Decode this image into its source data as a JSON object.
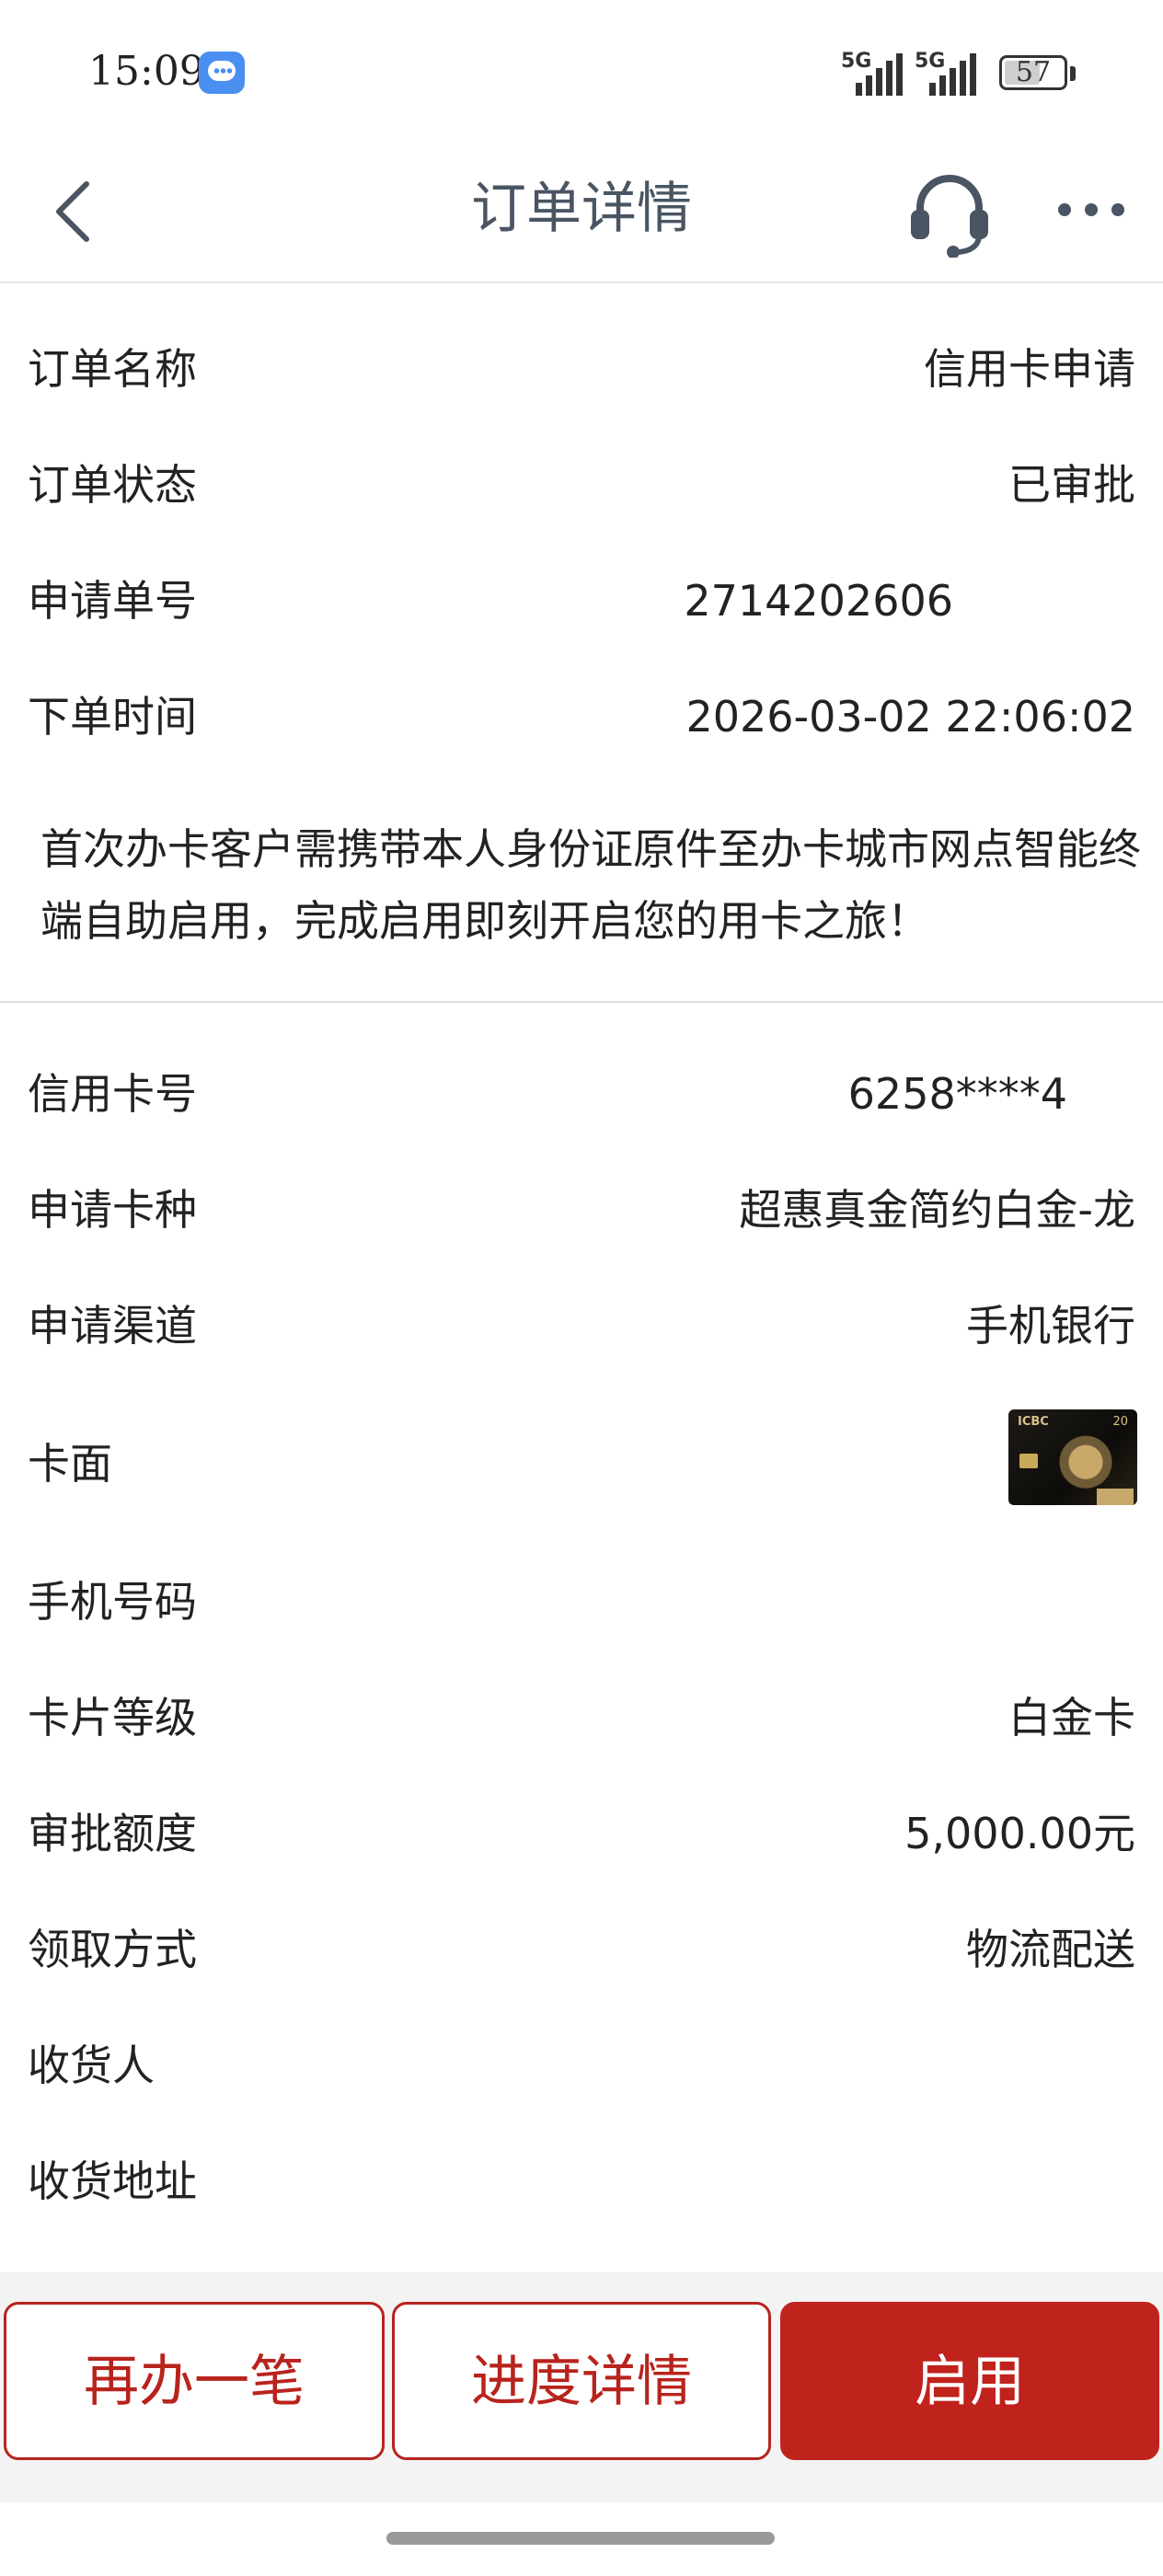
{
  "status_bar": {
    "time": "15:09",
    "battery": "57",
    "network1": "5G",
    "network2": "5G"
  },
  "header": {
    "title": "订单详情"
  },
  "order": {
    "rows": [
      {
        "label": "订单名称",
        "value": "信用卡申请"
      },
      {
        "label": "订单状态",
        "value": "已审批"
      },
      {
        "label": "申请单号",
        "value": "2714202606"
      },
      {
        "label": "下单时间",
        "value": "2026-03-02 22:06:02"
      }
    ],
    "notice": "首次办卡客户需携带本人身份证原件至办卡城市网点智能终端自助启用，完成启用即刻开启您的用卡之旅！"
  },
  "card": {
    "rows": [
      {
        "label": "信用卡号",
        "value": "6258****4"
      },
      {
        "label": "申请卡种",
        "value": "超惠真金简约白金-龙"
      },
      {
        "label": "申请渠道",
        "value": "手机银行"
      },
      {
        "label": "卡面",
        "value": ""
      },
      {
        "label": "手机号码",
        "value": ""
      },
      {
        "label": "卡片等级",
        "value": "白金卡"
      },
      {
        "label": "审批额度",
        "value": "5,000.00元"
      },
      {
        "label": "领取方式",
        "value": "物流配送"
      },
      {
        "label": "收货人",
        "value": ""
      },
      {
        "label": "收货地址",
        "value": ""
      }
    ],
    "face_logo": "ICBC",
    "face_number": "20"
  },
  "actions": {
    "again": "再办一笔",
    "progress": "进度详情",
    "activate": "启用"
  },
  "colors": {
    "accent": "#c0221c",
    "title": "#4a5563"
  }
}
